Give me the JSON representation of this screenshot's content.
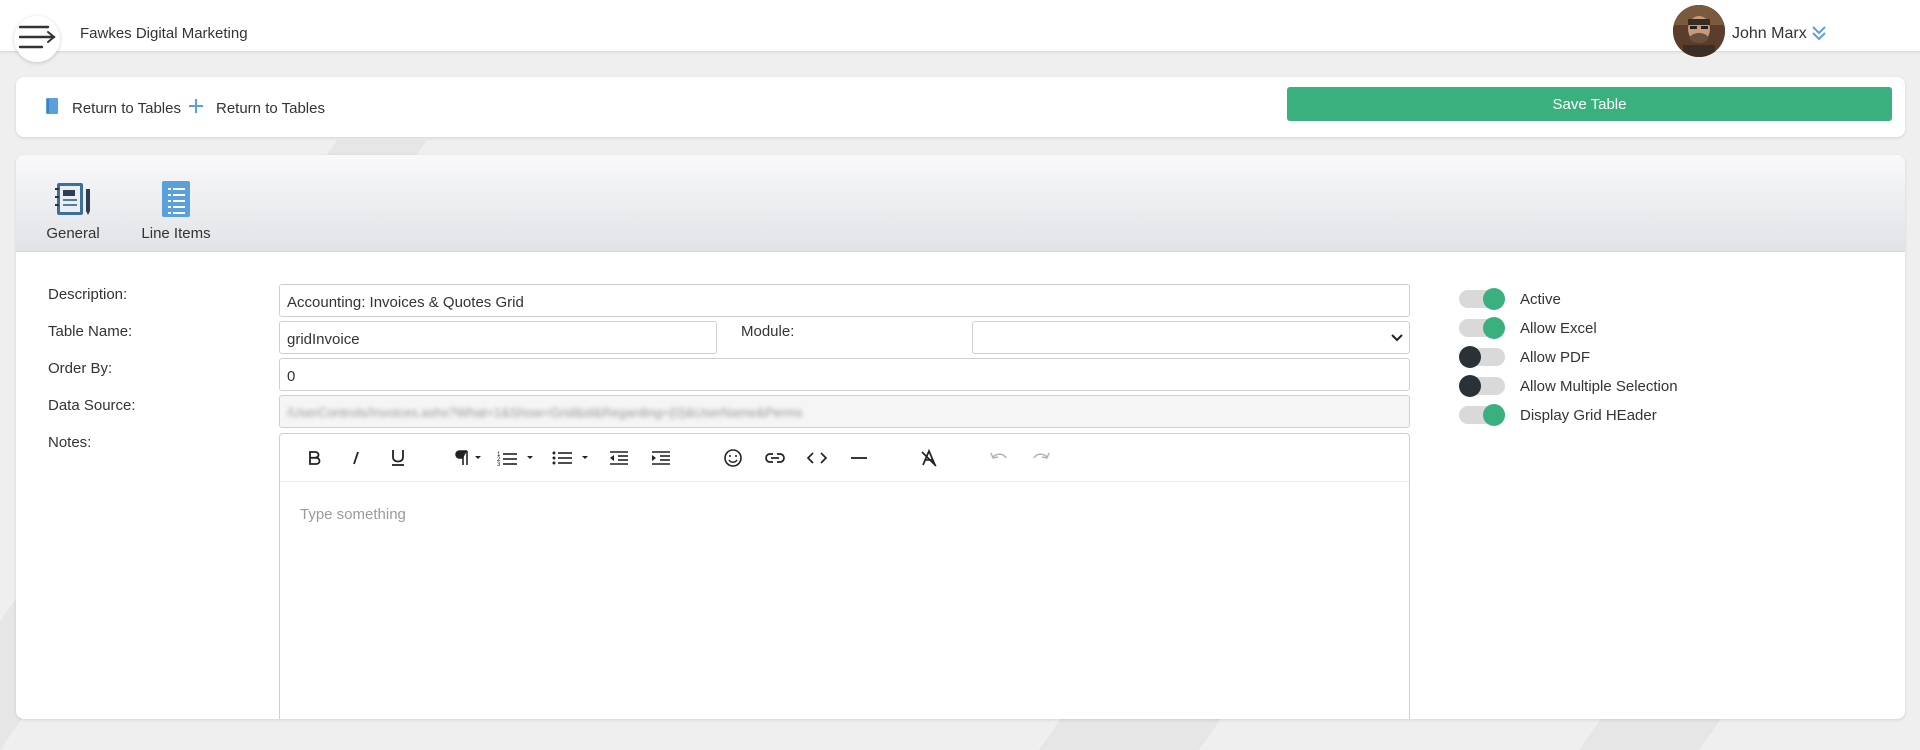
{
  "header": {
    "company": "Fawkes Digital Marketing",
    "user_name": "John Marx"
  },
  "actions": {
    "return_tables_1": "Return to Tables",
    "return_tables_2": "Return to Tables",
    "save_table": "Save Table"
  },
  "tabs": [
    {
      "label": "General"
    },
    {
      "label": "Line Items"
    }
  ],
  "form": {
    "description_label": "Description:",
    "description_value": "Accounting: Invoices & Quotes Grid",
    "table_name_label": "Table Name:",
    "table_name_value": "gridInvoice",
    "module_label": "Module:",
    "module_value": "",
    "order_by_label": "Order By:",
    "order_by_value": "0",
    "data_source_label": "Data Source:",
    "data_source_value": "/UserControls/Invoices.ashx?What=1&Show=Grid&id&Regarding={0}&UserName&Perms",
    "notes_label": "Notes:",
    "notes_placeholder": "Type something"
  },
  "toggles": [
    {
      "label": "Active",
      "on": true
    },
    {
      "label": "Allow Excel",
      "on": true
    },
    {
      "label": "Allow PDF",
      "on": false
    },
    {
      "label": "Allow Multiple Selection",
      "on": false
    },
    {
      "label": "Display Grid HEader",
      "on": true
    }
  ],
  "colors": {
    "accent": "#3bb07f",
    "toggle_off_knob": "#2a3238",
    "icon_blue": "#5aa0dd"
  },
  "icons": {
    "menu": "menu-icon",
    "user_chevron": "double-chevron-down-icon",
    "return_1": "book-icon",
    "return_2": "plus-icon",
    "tab_general": "notebook-pen-icon",
    "tab_line_items": "list-document-icon"
  }
}
